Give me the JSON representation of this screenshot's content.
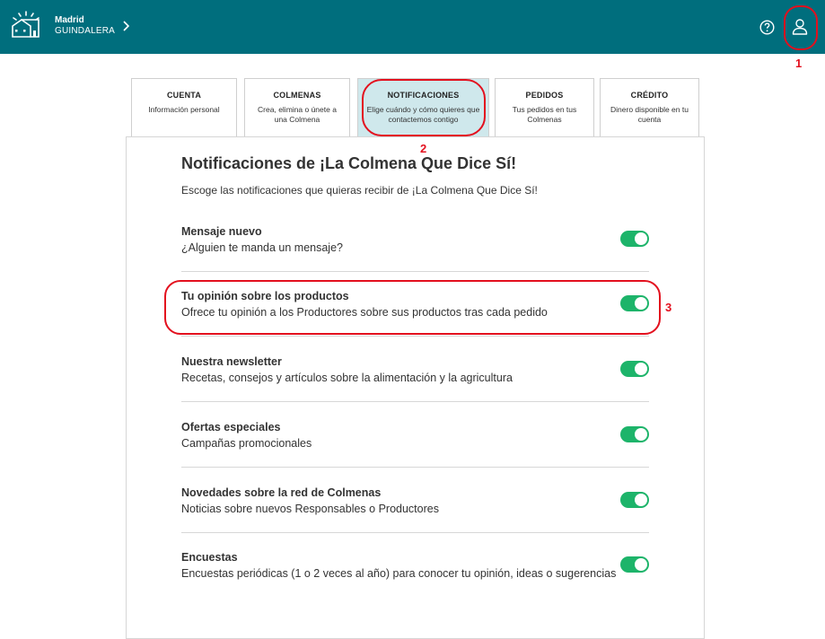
{
  "header": {
    "city": "Madrid",
    "hive_name": "GUINDALERA",
    "icons": [
      "house-logo-icon",
      "chevron-right-icon",
      "help-circle-icon",
      "user-icon"
    ],
    "colors": {
      "bar": "#006e7d",
      "toggle_on": "#1db46a",
      "active_tab": "#cfe8ec",
      "annotation": "#e3101e"
    }
  },
  "tabs": [
    {
      "title": "CUENTA",
      "subtitle": "Información personal",
      "active": false
    },
    {
      "title": "COLMENAS",
      "subtitle": "Crea, elimina o únete a una Colmena",
      "active": false
    },
    {
      "title": "NOTIFICACIONES",
      "subtitle": "Elige cuándo y cómo quieres que contactemos contigo",
      "active": true
    },
    {
      "title": "PEDIDOS",
      "subtitle": "Tus pedidos en tus Colmenas",
      "active": false
    },
    {
      "title": "CRÉDITO",
      "subtitle": "Dinero disponible en tu cuenta",
      "active": false
    }
  ],
  "main": {
    "title": "Notificaciones de ¡La Colmena Que Dice Sí!",
    "description": "Escoge las notificaciones que quieras recibir de ¡La Colmena Que Dice Sí!",
    "settings": [
      {
        "title": "Mensaje nuevo",
        "description": "¿Alguien te manda un mensaje?",
        "enabled": true
      },
      {
        "title": "Tu opinión sobre los productos",
        "description": "Ofrece tu opinión a los Productores sobre sus productos tras cada pedido",
        "enabled": true
      },
      {
        "title": "Nuestra newsletter",
        "description": "Recetas, consejos y artículos sobre la alimentación y la agricultura",
        "enabled": true
      },
      {
        "title": "Ofertas especiales",
        "description": "Campañas promocionales",
        "enabled": true
      },
      {
        "title": "Novedades sobre la red de Colmenas",
        "description": "Noticias sobre nuevos Responsables o Productores",
        "enabled": true
      },
      {
        "title": "Encuestas",
        "description": "Encuestas periódicas (1 o 2 veces al año) para conocer tu opinión, ideas o sugerencias",
        "enabled": true
      }
    ]
  },
  "annotations": [
    "1",
    "2",
    "3"
  ]
}
